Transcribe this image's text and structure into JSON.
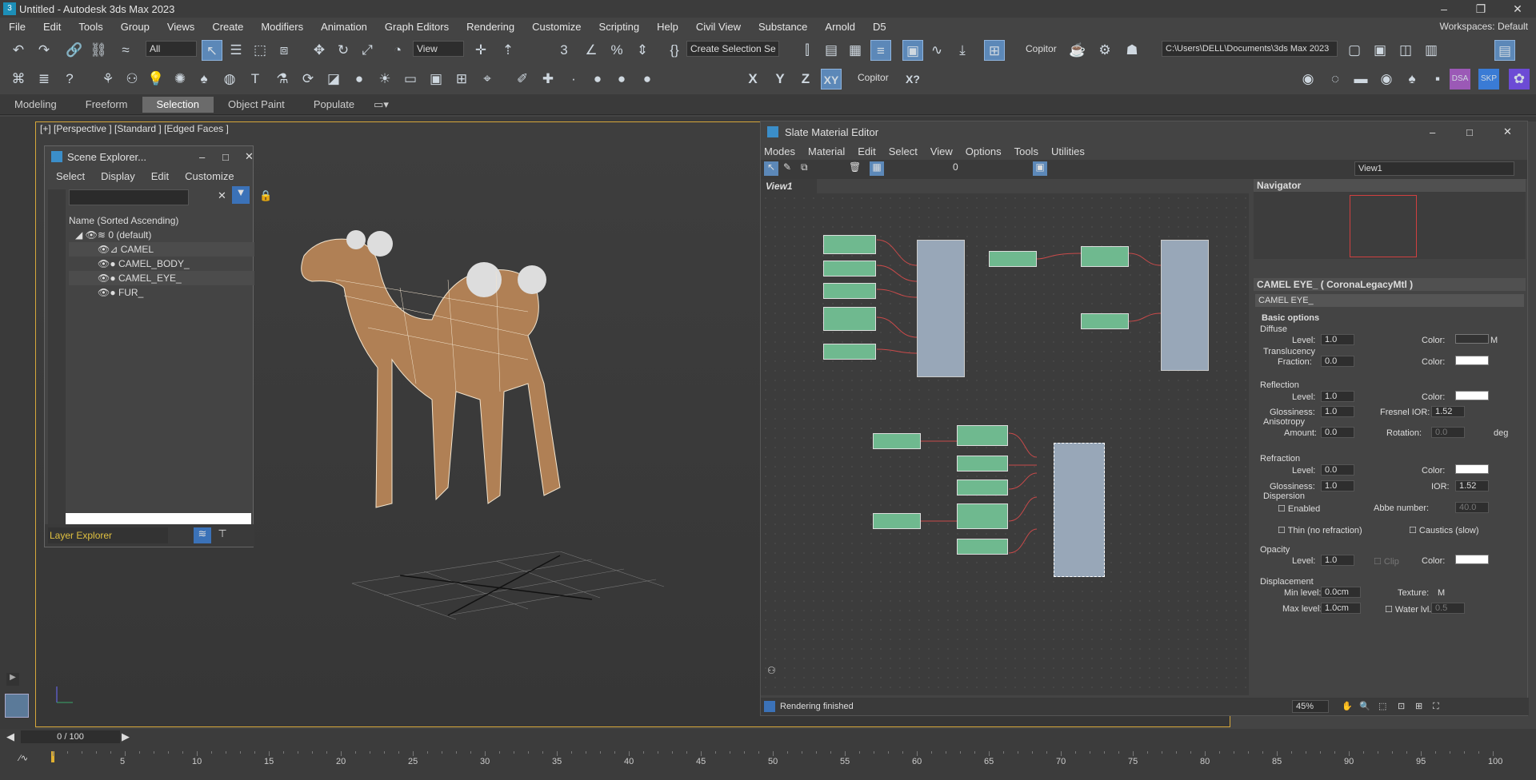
{
  "titlebar": {
    "title": "Untitled - Autodesk 3ds Max 2023"
  },
  "menu": [
    "File",
    "Edit",
    "Tools",
    "Group",
    "Views",
    "Create",
    "Modifiers",
    "Animation",
    "Graph Editors",
    "Rendering",
    "Customize",
    "Scripting",
    "Help",
    "Civil View",
    "Substance",
    "Arnold",
    "D5"
  ],
  "workspace": "Workspaces: Default",
  "toolbar": {
    "filter": "All",
    "refcoord": "View",
    "selset": "Create Selection Se",
    "copitor": "Copitor",
    "path": "C:\\Users\\DELL\\Documents\\3ds Max 2023",
    "copitor2": "Copitor"
  },
  "axes": {
    "x": "X",
    "y": "Y",
    "z": "Z",
    "xy": "XY",
    "xq": "X?"
  },
  "ribbon": [
    "Modeling",
    "Freeform",
    "Selection",
    "Object Paint",
    "Populate"
  ],
  "viewport": {
    "label": "[+] [Perspective ] [Standard ] [Edged Faces ]"
  },
  "scene_explorer": {
    "title": "Scene Explorer...",
    "menu": [
      "Select",
      "Display",
      "Edit",
      "Customize"
    ],
    "column": "Name (Sorted Ascending)",
    "root": "0 (default)",
    "items": [
      "CAMEL",
      "CAMEL_BODY_",
      "CAMEL_EYE_",
      "FUR_"
    ],
    "footer": "Layer Explorer"
  },
  "slate": {
    "title": "Slate Material Editor",
    "menu": [
      "Modes",
      "Material",
      "Edit",
      "Select",
      "View",
      "Options",
      "Tools",
      "Utilities"
    ],
    "view_tab": "View1",
    "view_dropdown": "View1",
    "navigator": "Navigator",
    "prop_title": "CAMEL EYE_  ( CoronaLegacyMtl )",
    "name_field": "CAMEL EYE_",
    "status": "Rendering finished",
    "zoom": "45%",
    "props": {
      "basic": "Basic options",
      "diffuse": "Diffuse",
      "level": "Level:",
      "color": "Color:",
      "translucency": "Translucency",
      "fraction": "Fraction:",
      "reflection": "Reflection",
      "glossiness": "Glossiness:",
      "fresnel": "Fresnel IOR:",
      "anisotropy": "Anisotropy",
      "amount": "Amount:",
      "rotation": "Rotation:",
      "deg": "deg",
      "refraction": "Refraction",
      "ior": "IOR:",
      "dispersion": "Dispersion",
      "enabled": "Enabled",
      "abbe": "Abbe number:",
      "thin": "Thin (no refraction)",
      "caustics": "Caustics (slow)",
      "opacity": "Opacity",
      "clip": "Clip",
      "displacement": "Displacement",
      "minlevel": "Min level:",
      "maxlevel": "Max level:",
      "texture": "Texture:",
      "water": "Water lvl.",
      "m": "M",
      "v10": "1.0",
      "v00": "0.0",
      "v152": "1.52",
      "v400": "40.0",
      "v05": "0.5",
      "v00cm": "0.0cm",
      "v10cm": "1.0cm"
    }
  },
  "timeline": {
    "frame": "0 / 100",
    "ticks": [
      "5",
      "10",
      "15",
      "20",
      "25",
      "30",
      "35",
      "40",
      "45",
      "50",
      "55",
      "60",
      "65",
      "70",
      "75",
      "80",
      "85",
      "90",
      "95",
      "100"
    ]
  }
}
